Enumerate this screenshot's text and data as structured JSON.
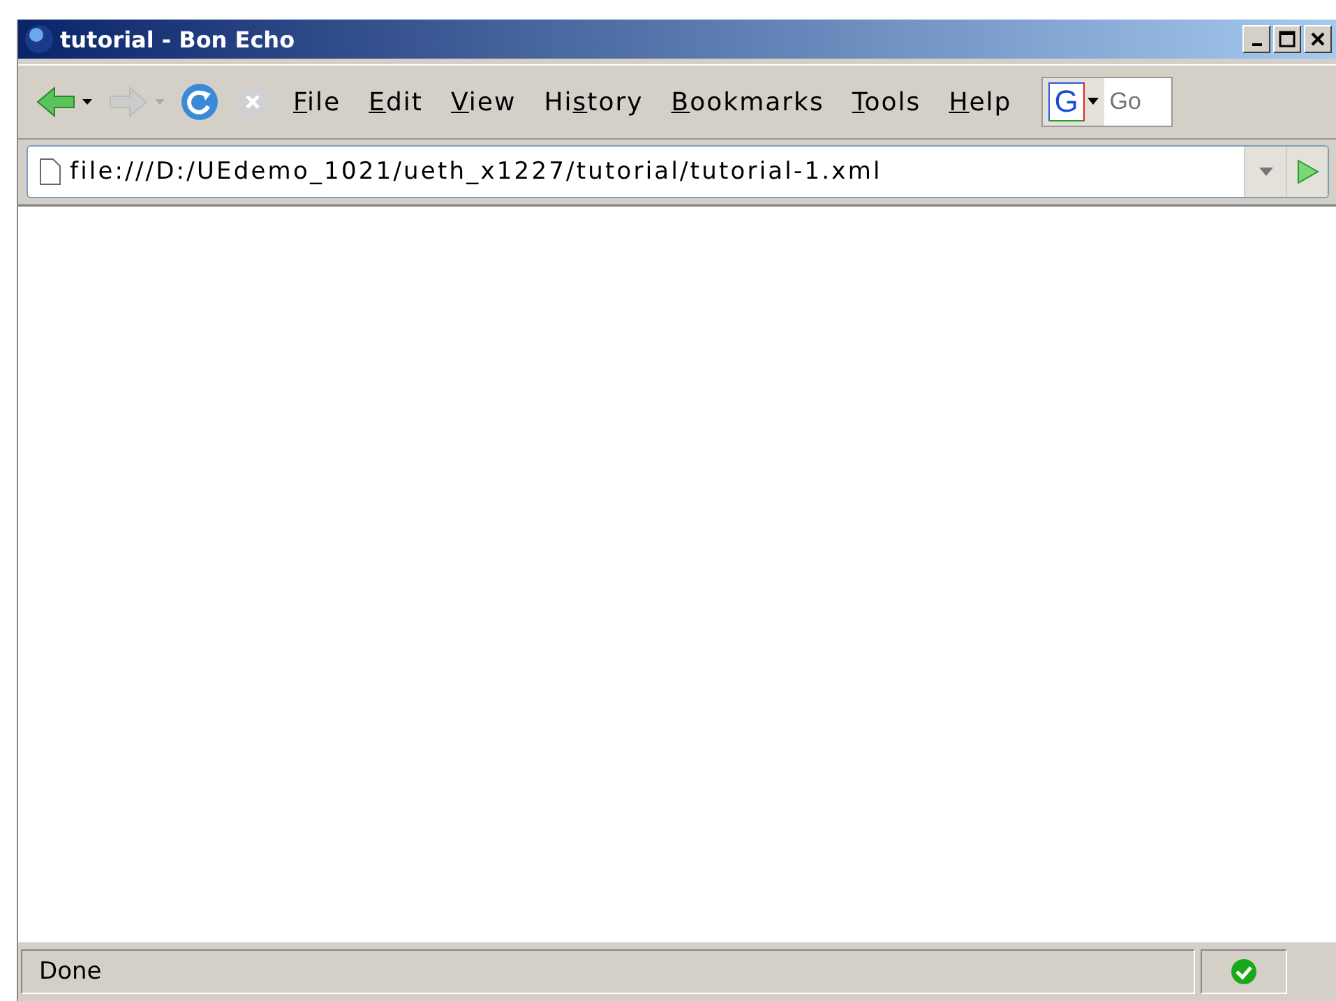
{
  "window": {
    "title": "tutorial - Bon Echo"
  },
  "menu": [
    {
      "key": "F",
      "post": "ile"
    },
    {
      "key": "E",
      "post": "dit"
    },
    {
      "key": "V",
      "post": "iew"
    },
    {
      "pre": "Hi",
      "key": "s",
      "post": "tory"
    },
    {
      "key": "B",
      "post": "ookmarks"
    },
    {
      "key": "T",
      "post": "ools"
    },
    {
      "key": "H",
      "post": "elp"
    }
  ],
  "search": {
    "engine_logo": "G",
    "placeholder": "Go"
  },
  "address": {
    "value": "file:///D:/UEdemo_1021/ueth_x1227/tutorial/tutorial-1.xml"
  },
  "status_bar": {
    "text": "Done"
  }
}
